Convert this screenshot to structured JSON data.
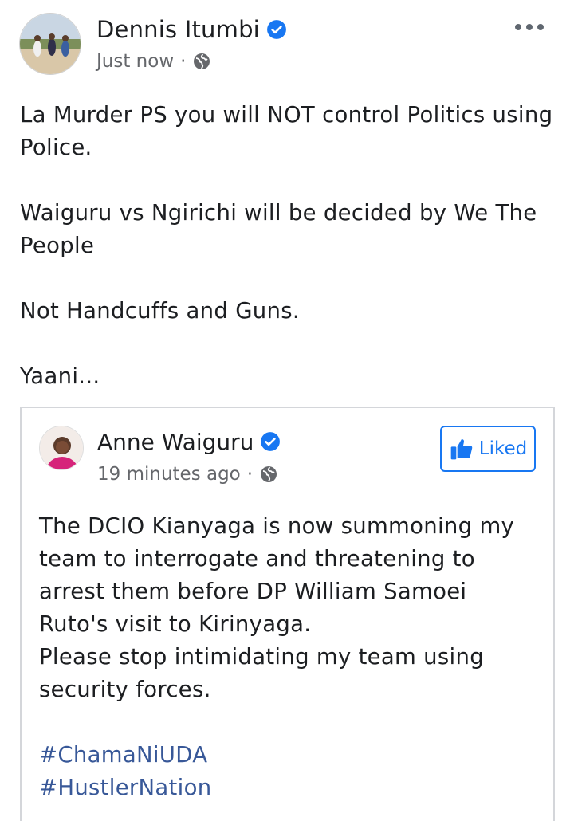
{
  "post": {
    "author": "Dennis Itumbi",
    "timestamp": "Just now",
    "separator": "·",
    "icons": {
      "verified": "verified-badge-icon",
      "audience": "globe-icon",
      "more": "more-options-icon"
    },
    "paragraphs": [
      "La Murder PS you will NOT control Politics using Police.",
      "Waiguru vs Ngirichi will be decided by We The People",
      "Not Handcuffs and Guns.",
      "Yaani..."
    ]
  },
  "shared_post": {
    "author": "Anne Waiguru",
    "timestamp": "19 minutes ago",
    "separator": "·",
    "like_button_label": "Liked",
    "lines": [
      "The DCIO Kianyaga is now summoning my team to interrogate and threatening to arrest them before DP William Samoei Ruto's visit to Kirinyaga.",
      "Please stop intimidating my team using security forces."
    ],
    "hashtags": [
      "#ChamaNiUDA",
      "#HustlerNation"
    ]
  },
  "colors": {
    "accent": "#1877f2",
    "hashtag": "#385898",
    "meta_text": "#65676b",
    "card_border": "#d4d6da"
  }
}
